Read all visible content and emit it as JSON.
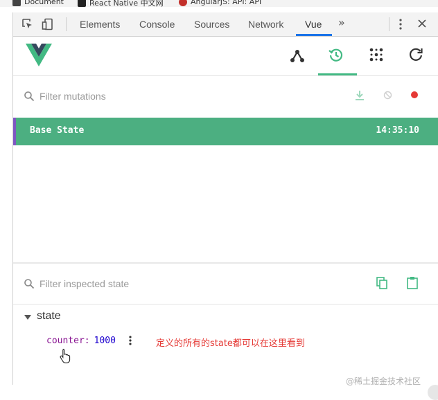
{
  "bookmarks": [
    {
      "label": "Document"
    },
    {
      "label": "React Native 中文网"
    },
    {
      "label": "AngularJS: API: API"
    }
  ],
  "devtools_tabs": [
    {
      "label": "Elements"
    },
    {
      "label": "Console"
    },
    {
      "label": "Sources"
    },
    {
      "label": "Network"
    },
    {
      "label": "Vue",
      "active": true
    }
  ],
  "vue_nav": {
    "icons": [
      "components-icon",
      "vuex-history-icon",
      "events-icon",
      "refresh-icon"
    ],
    "active": "vuex-history-icon",
    "accent": "#42b983"
  },
  "mutations": {
    "filter_placeholder": "Filter mutations",
    "entries": [
      {
        "label": "Base State",
        "time": "14:35:10",
        "selected": true
      }
    ],
    "row_color": "#4caf81",
    "record_color": "#e53935"
  },
  "inspector": {
    "filter_placeholder": "Filter inspected state",
    "tree": {
      "key": "state",
      "props": [
        {
          "key": "counter",
          "value": "1000"
        }
      ]
    }
  },
  "annotation": "定义的所有的state都可以在这里看到",
  "watermark": "@稀土掘金技术社区"
}
